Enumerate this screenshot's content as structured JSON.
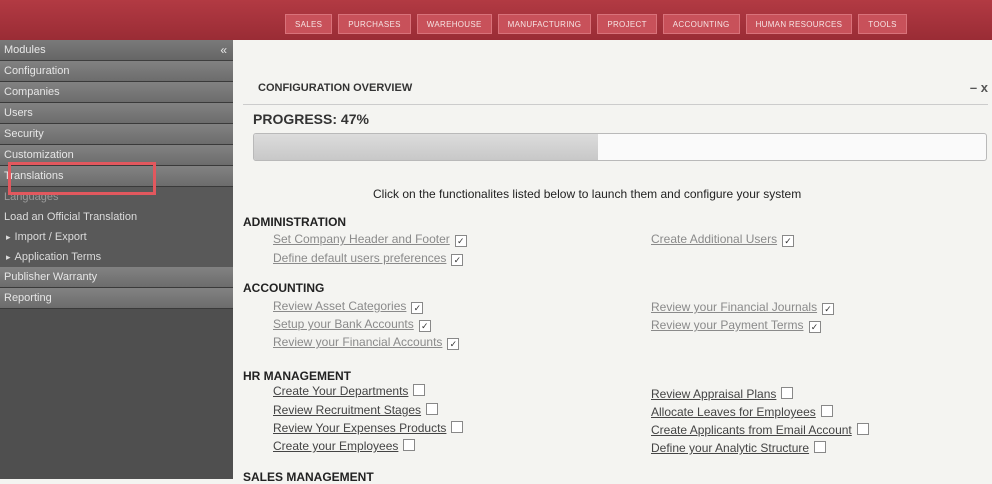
{
  "nav": {
    "tabs": [
      "SALES",
      "PURCHASES",
      "WAREHOUSE",
      "MANUFACTURING",
      "PROJECT",
      "ACCOUNTING",
      "HUMAN RESOURCES",
      "TOOLS"
    ]
  },
  "sidebar": {
    "title": "Modules",
    "collapse": "«",
    "top_items": [
      "Configuration",
      "Companies",
      "Users",
      "Security",
      "Customization",
      "Translations"
    ],
    "sub_items": [
      "Languages",
      "Load an Official Translation",
      "Import / Export",
      "Application Terms"
    ],
    "bottom_items": [
      "Publisher Warranty",
      "Reporting"
    ]
  },
  "panel": {
    "title": "CONFIGURATION OVERVIEW",
    "controls": "– x",
    "progress_label": "PROGRESS: 47%",
    "progress_value": 0.47,
    "intro": "Click on the functionalites listed below to launch them and configure your system"
  },
  "sections": [
    {
      "title": "ADMINISTRATION",
      "left": [
        {
          "label": "Set Company Header and Footer",
          "checked": true
        },
        {
          "label": "Define default users preferences",
          "checked": true
        }
      ],
      "right": [
        {
          "label": "Create Additional Users",
          "checked": true
        }
      ]
    },
    {
      "title": "ACCOUNTING",
      "left": [
        {
          "label": "Review Asset Categories",
          "checked": true
        },
        {
          "label": "Setup your Bank Accounts",
          "checked": true
        },
        {
          "label": "Review your Financial Accounts",
          "checked": true
        }
      ],
      "right": [
        {
          "label": "Review your Financial Journals",
          "checked": true
        },
        {
          "label": "Review your Payment Terms",
          "checked": true
        }
      ]
    },
    {
      "title": "HR MANAGEMENT",
      "left": [
        {
          "label": "Create Your Departments",
          "checked": false
        },
        {
          "label": "Review Recruitment Stages",
          "checked": false
        },
        {
          "label": "Review Your Expenses Products",
          "checked": false
        },
        {
          "label": "Create your Employees",
          "checked": false
        }
      ],
      "right": [
        {
          "label": "Review Appraisal Plans",
          "checked": false
        },
        {
          "label": "Allocate Leaves for Employees",
          "checked": false
        },
        {
          "label": "Create Applicants from Email Account",
          "checked": false
        },
        {
          "label": "Define your Analytic Structure",
          "checked": false
        }
      ]
    },
    {
      "title": "SALES MANAGEMENT",
      "left": [],
      "right": []
    }
  ]
}
